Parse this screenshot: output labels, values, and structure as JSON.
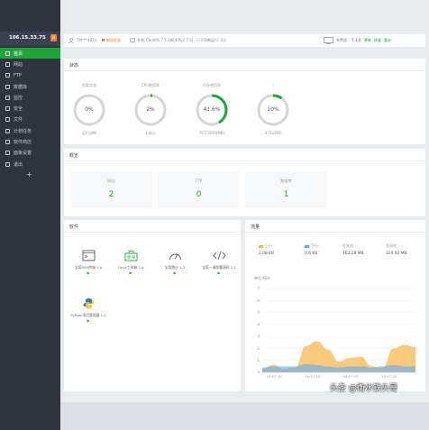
{
  "sidebar": {
    "ip": "106.15.33.75",
    "badge": "8",
    "items": [
      {
        "label": "首页",
        "active": true
      },
      {
        "label": "网站"
      },
      {
        "label": "FTP"
      },
      {
        "label": "数据库"
      },
      {
        "label": "监控"
      },
      {
        "label": "安全"
      },
      {
        "label": "文件"
      },
      {
        "label": "计划任务"
      },
      {
        "label": "软件商店"
      },
      {
        "label": "面板设置"
      },
      {
        "label": "退出"
      }
    ],
    "add": "+"
  },
  "topbar": {
    "user": "TM***4823",
    "bind": "解绑此账",
    "system_label": "系统:",
    "system": "CentOS 7.5.1804(Py2.7.5)",
    "uptime": "已不间断运行: 2天",
    "version_label": "免费版",
    "version": "7.1.0",
    "update": "更新",
    "repair": "修复",
    "restart": "重启"
  },
  "status": {
    "title": "状态",
    "gauges": [
      {
        "top": "负载状态",
        "value": "0%",
        "bottom": "运行流畅",
        "pct": 0
      },
      {
        "top": "CPU使用率",
        "value": "2%",
        "bottom": "1 核心",
        "pct": 2
      },
      {
        "top": "内存使用率",
        "value": "41.6%",
        "bottom": "767/1839(MB)",
        "pct": 41.6
      },
      {
        "top": "/",
        "value": "10%",
        "bottom": "3.7G/40G",
        "pct": 10
      }
    ]
  },
  "overview": {
    "title": "概览",
    "boxes": [
      {
        "label": "网站",
        "value": "2"
      },
      {
        "label": "FTP",
        "value": "0"
      },
      {
        "label": "数据库",
        "value": "1"
      }
    ]
  },
  "software": {
    "title": "软件",
    "items": [
      {
        "label": "宝塔SSH终端 1.0",
        "icon": "terminal-icon"
      },
      {
        "label": "Linux工具箱 1.4",
        "icon": "toolbox-icon"
      },
      {
        "label": "宝塔跑分 1.3",
        "icon": "gauge-icon"
      },
      {
        "label": "宝塔一键部署源码 1.1",
        "icon": "code-icon"
      },
      {
        "label": "Python项目管理器 1.1",
        "icon": "python-icon"
      }
    ]
  },
  "traffic": {
    "title": "流量",
    "stats": [
      {
        "label": "上行",
        "value": "2.08 KB",
        "color": "#f7b851"
      },
      {
        "label": "下行",
        "value": "0.6 KB",
        "color": "#52a9ff"
      },
      {
        "label": "总发送",
        "value": "162.28 MB"
      },
      {
        "label": "总接收",
        "value": "324.92 MB"
      }
    ],
    "unit": "单位:KB/s",
    "chart_data": {
      "type": "area",
      "x": [
        "16:57:10",
        "16:57:15",
        "16:57:20",
        "16:57:25"
      ],
      "ylim": [
        0,
        7
      ],
      "yticks": [
        "0",
        "1",
        "2",
        "3",
        "4",
        "5",
        "6",
        "7"
      ],
      "series": [
        {
          "name": "上行",
          "color": "#f7b851",
          "values": [
            0.3,
            0.6,
            0.3,
            0.4,
            2.2,
            2.6,
            1.9,
            0.9,
            1.2,
            1.3,
            0.5,
            0.4,
            2.0,
            2.3,
            2.1
          ]
        },
        {
          "name": "下行",
          "color": "#52a9ff",
          "values": [
            0.4,
            0.5,
            0.5,
            0.5,
            0.7,
            0.6,
            0.5,
            0.4,
            0.5,
            0.5,
            0.4,
            0.5,
            0.6,
            0.5,
            0.5
          ]
        }
      ]
    }
  },
  "watermark": "头条 @衡水铁头哥"
}
